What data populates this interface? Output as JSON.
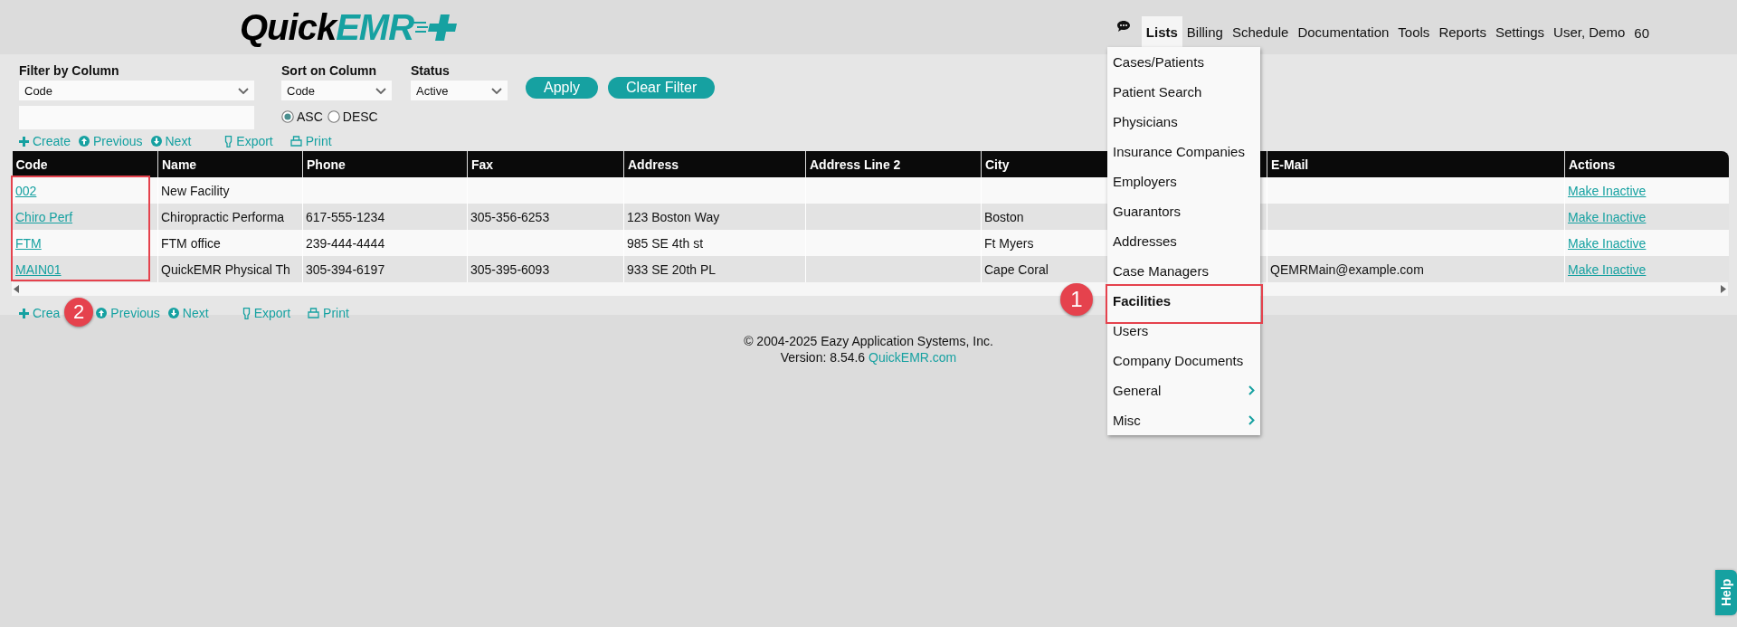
{
  "logo": {
    "part_1": "Quick",
    "part_2": "EMR"
  },
  "nav": {
    "items": [
      {
        "label": "Lists",
        "selected": true
      },
      {
        "label": "Billing",
        "selected": false
      },
      {
        "label": "Schedule",
        "selected": false
      },
      {
        "label": "Documentation",
        "selected": false
      },
      {
        "label": "Tools",
        "selected": false
      },
      {
        "label": "Reports",
        "selected": false
      },
      {
        "label": "Settings",
        "selected": false
      },
      {
        "label": "User, Demo",
        "selected": false
      }
    ],
    "counter": "60"
  },
  "filters": {
    "filter_label": "Filter by Column",
    "filter_value": "Code",
    "sort_label": "Sort on Column",
    "sort_value": "Code",
    "status_label": "Status",
    "status_value": "Active",
    "order": [
      {
        "label": "ASC",
        "selected": true
      },
      {
        "label": "DESC",
        "selected": false
      }
    ],
    "buttons": [
      "Apply",
      "Clear Filter"
    ]
  },
  "toolbar_top": [
    {
      "kind": "create",
      "label": "Create"
    },
    {
      "kind": "previous",
      "label": "Previous"
    },
    {
      "kind": "next",
      "label": "Next"
    },
    {
      "kind": "export",
      "label": "Export"
    },
    {
      "kind": "print",
      "label": "Print"
    }
  ],
  "table": {
    "columns": [
      {
        "label": "Code",
        "callout": "2"
      },
      {
        "label": "Name"
      },
      {
        "label": "Phone"
      },
      {
        "label": "Fax"
      },
      {
        "label": "Address"
      },
      {
        "label": "Address Line 2"
      },
      {
        "label": "City"
      },
      {},
      {
        "label": "E-Mail"
      },
      {
        "label": "Actions"
      }
    ],
    "rows": [
      {
        "code": "002",
        "name": "New Facility",
        "action": "Make Inactive"
      },
      {
        "code": "Chiro Perf",
        "name": "Chiropractic Performa",
        "phone": "617-555-1234",
        "fax": "305-356-6253",
        "address": "123 Boston Way",
        "city": "Boston",
        "action": "Make Inactive"
      },
      {
        "code": "FTM",
        "name": "FTM office",
        "phone": "239-444-4444",
        "address": "985 SE 4th st",
        "city": "Ft Myers",
        "action": "Make Inactive"
      },
      {
        "code": "MAIN01",
        "name": "QuickEMR Physical Th",
        "phone": "305-394-6197",
        "fax": "305-395-6093",
        "address": "933 SE 20th PL",
        "city": "Cape Coral",
        "email": "QEMRMain@example.com",
        "action": "Make Inactive"
      }
    ]
  },
  "toolbar_bottom": [
    {
      "kind": "create",
      "label": "Crea"
    },
    {
      "kind": "previous",
      "label": "Previous"
    },
    {
      "kind": "next",
      "label": "Next"
    },
    {
      "kind": "export",
      "label": "Export"
    },
    {
      "kind": "print",
      "label": "Print"
    }
  ],
  "footer": {
    "copyright": "© 2004-2025 Eazy Application Systems, Inc.",
    "version": "Version: 8.54.6",
    "link": "QuickEMR.com"
  },
  "menu": {
    "items": [
      {
        "label": "Cases/Patients",
        "selected": false,
        "submenu": false
      },
      {
        "label": "Patient Search",
        "selected": false,
        "submenu": false
      },
      {
        "label": "Physicians",
        "selected": false,
        "submenu": false
      },
      {
        "label": "Insurance Companies",
        "selected": false,
        "submenu": false
      },
      {
        "label": "Employers",
        "selected": false,
        "submenu": false
      },
      {
        "label": "Guarantors",
        "selected": false,
        "submenu": false
      },
      {
        "label": "Addresses",
        "selected": false,
        "submenu": false
      },
      {
        "label": "Case Managers",
        "selected": false,
        "submenu": false
      },
      {
        "label": "Facilities",
        "selected": true,
        "submenu": false,
        "callout": "1"
      },
      {
        "label": "Users",
        "selected": false,
        "submenu": false
      },
      {
        "label": "Company Documents",
        "selected": false,
        "submenu": false
      },
      {
        "label": "General",
        "selected": false,
        "submenu": true
      },
      {
        "label": "Misc",
        "selected": false,
        "submenu": true
      }
    ]
  },
  "help": "Help"
}
